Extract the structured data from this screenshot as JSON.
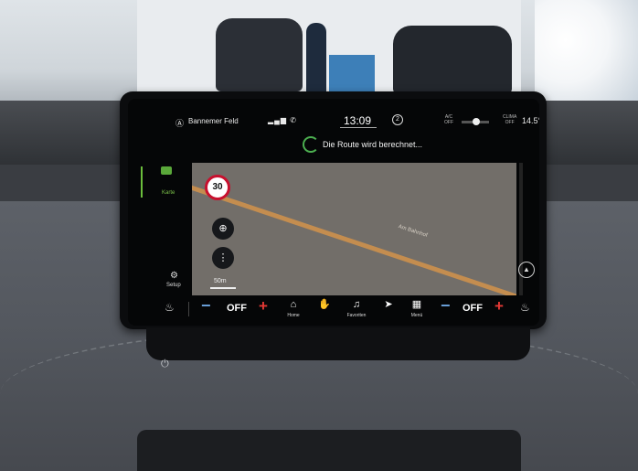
{
  "statusbar": {
    "nav_source": "Bannemer Feld",
    "signal": "4G",
    "clock": "13:09",
    "notifications": "2",
    "ac_label": "A/C\nOFF",
    "clima_label": "CLIMA\nOFF",
    "temperature": "14.5°C"
  },
  "route": {
    "message": "Die Route wird berechnet..."
  },
  "rail": {
    "karte": "Karte",
    "setup": "Setup"
  },
  "map": {
    "speed_limit": "30",
    "road_name": "Am Bahnhof",
    "scale": "50m"
  },
  "climate_left": {
    "minus": "−",
    "value": "OFF",
    "plus": "+"
  },
  "climate_right": {
    "minus": "−",
    "value": "OFF",
    "plus": "+"
  },
  "dock": {
    "home": "Home",
    "favoriten": "Favoriten",
    "menu": "Menü"
  },
  "icons": {
    "karte": "map-icon",
    "setup": "gear-icon",
    "home": "home-icon",
    "favoriten": "music-note-icon",
    "navigate": "arrow-navigation-icon",
    "menu": "grid-icon",
    "compass": "compass-icon",
    "seat": "seat-heating-icon"
  },
  "colors": {
    "accent_green": "#6bbd3c",
    "minus_blue": "#6a9fd8",
    "plus_red": "#e53935",
    "map_bg": "#726e69",
    "road": "#c48d4f"
  }
}
